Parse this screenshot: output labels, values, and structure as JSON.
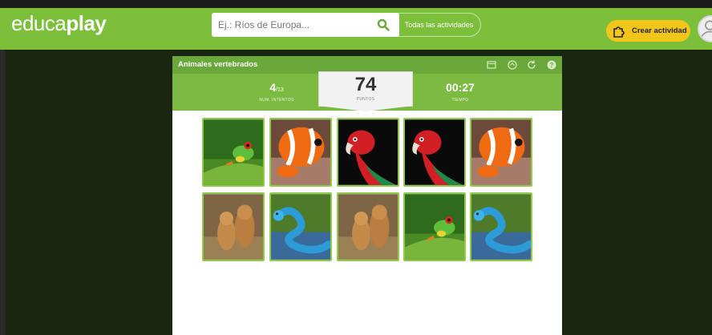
{
  "header": {
    "logo_prefix": "educa",
    "logo_suffix": "play",
    "search_placeholder": "Ej.: Ríos de Europa...",
    "all_activities": "Todas las actividades",
    "create_button": "Crear actividad",
    "colors": {
      "bar": "#7bbf3a",
      "create": "#f2c618"
    }
  },
  "game": {
    "title": "Animales vertebrados",
    "attempts_value": "4",
    "attempts_total": "/13",
    "attempts_label": "NUM. INTENTOS",
    "points_value": "74",
    "points_label": "PUNTOS",
    "time_value": "00:27",
    "time_label": "TIEMPO",
    "header_icons": [
      "fullscreen-icon",
      "share-icon",
      "restart-icon",
      "help-icon"
    ],
    "cards": [
      {
        "animal": "frog",
        "row": 1,
        "col": 1
      },
      {
        "animal": "clownfish",
        "row": 1,
        "col": 2
      },
      {
        "animal": "parrot",
        "row": 1,
        "col": 3
      },
      {
        "animal": "parrot",
        "row": 1,
        "col": 4
      },
      {
        "animal": "clownfish",
        "row": 1,
        "col": 5
      },
      {
        "animal": "lions",
        "row": 2,
        "col": 1
      },
      {
        "animal": "snake",
        "row": 2,
        "col": 2
      },
      {
        "animal": "lions",
        "row": 2,
        "col": 3
      },
      {
        "animal": "frog",
        "row": 2,
        "col": 4
      },
      {
        "animal": "snake",
        "row": 2,
        "col": 5
      }
    ]
  }
}
